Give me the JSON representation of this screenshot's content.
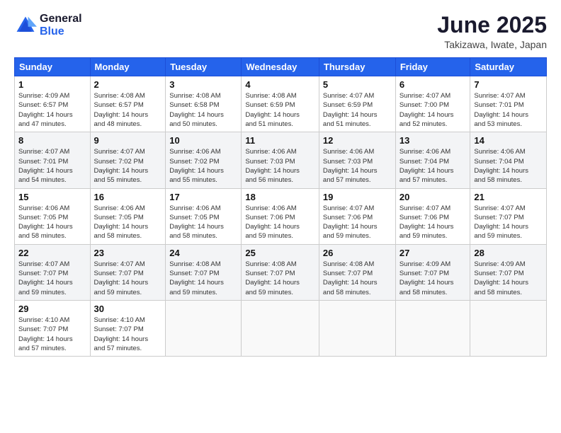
{
  "header": {
    "logo_general": "General",
    "logo_blue": "Blue",
    "title": "June 2025",
    "subtitle": "Takizawa, Iwate, Japan"
  },
  "weekdays": [
    "Sunday",
    "Monday",
    "Tuesday",
    "Wednesday",
    "Thursday",
    "Friday",
    "Saturday"
  ],
  "weeks": [
    [
      {
        "day": "1",
        "info": "Sunrise: 4:09 AM\nSunset: 6:57 PM\nDaylight: 14 hours\nand 47 minutes."
      },
      {
        "day": "2",
        "info": "Sunrise: 4:08 AM\nSunset: 6:57 PM\nDaylight: 14 hours\nand 48 minutes."
      },
      {
        "day": "3",
        "info": "Sunrise: 4:08 AM\nSunset: 6:58 PM\nDaylight: 14 hours\nand 50 minutes."
      },
      {
        "day": "4",
        "info": "Sunrise: 4:08 AM\nSunset: 6:59 PM\nDaylight: 14 hours\nand 51 minutes."
      },
      {
        "day": "5",
        "info": "Sunrise: 4:07 AM\nSunset: 6:59 PM\nDaylight: 14 hours\nand 51 minutes."
      },
      {
        "day": "6",
        "info": "Sunrise: 4:07 AM\nSunset: 7:00 PM\nDaylight: 14 hours\nand 52 minutes."
      },
      {
        "day": "7",
        "info": "Sunrise: 4:07 AM\nSunset: 7:01 PM\nDaylight: 14 hours\nand 53 minutes."
      }
    ],
    [
      {
        "day": "8",
        "info": "Sunrise: 4:07 AM\nSunset: 7:01 PM\nDaylight: 14 hours\nand 54 minutes."
      },
      {
        "day": "9",
        "info": "Sunrise: 4:07 AM\nSunset: 7:02 PM\nDaylight: 14 hours\nand 55 minutes."
      },
      {
        "day": "10",
        "info": "Sunrise: 4:06 AM\nSunset: 7:02 PM\nDaylight: 14 hours\nand 55 minutes."
      },
      {
        "day": "11",
        "info": "Sunrise: 4:06 AM\nSunset: 7:03 PM\nDaylight: 14 hours\nand 56 minutes."
      },
      {
        "day": "12",
        "info": "Sunrise: 4:06 AM\nSunset: 7:03 PM\nDaylight: 14 hours\nand 57 minutes."
      },
      {
        "day": "13",
        "info": "Sunrise: 4:06 AM\nSunset: 7:04 PM\nDaylight: 14 hours\nand 57 minutes."
      },
      {
        "day": "14",
        "info": "Sunrise: 4:06 AM\nSunset: 7:04 PM\nDaylight: 14 hours\nand 58 minutes."
      }
    ],
    [
      {
        "day": "15",
        "info": "Sunrise: 4:06 AM\nSunset: 7:05 PM\nDaylight: 14 hours\nand 58 minutes."
      },
      {
        "day": "16",
        "info": "Sunrise: 4:06 AM\nSunset: 7:05 PM\nDaylight: 14 hours\nand 58 minutes."
      },
      {
        "day": "17",
        "info": "Sunrise: 4:06 AM\nSunset: 7:05 PM\nDaylight: 14 hours\nand 58 minutes."
      },
      {
        "day": "18",
        "info": "Sunrise: 4:06 AM\nSunset: 7:06 PM\nDaylight: 14 hours\nand 59 minutes."
      },
      {
        "day": "19",
        "info": "Sunrise: 4:07 AM\nSunset: 7:06 PM\nDaylight: 14 hours\nand 59 minutes."
      },
      {
        "day": "20",
        "info": "Sunrise: 4:07 AM\nSunset: 7:06 PM\nDaylight: 14 hours\nand 59 minutes."
      },
      {
        "day": "21",
        "info": "Sunrise: 4:07 AM\nSunset: 7:07 PM\nDaylight: 14 hours\nand 59 minutes."
      }
    ],
    [
      {
        "day": "22",
        "info": "Sunrise: 4:07 AM\nSunset: 7:07 PM\nDaylight: 14 hours\nand 59 minutes."
      },
      {
        "day": "23",
        "info": "Sunrise: 4:07 AM\nSunset: 7:07 PM\nDaylight: 14 hours\nand 59 minutes."
      },
      {
        "day": "24",
        "info": "Sunrise: 4:08 AM\nSunset: 7:07 PM\nDaylight: 14 hours\nand 59 minutes."
      },
      {
        "day": "25",
        "info": "Sunrise: 4:08 AM\nSunset: 7:07 PM\nDaylight: 14 hours\nand 59 minutes."
      },
      {
        "day": "26",
        "info": "Sunrise: 4:08 AM\nSunset: 7:07 PM\nDaylight: 14 hours\nand 58 minutes."
      },
      {
        "day": "27",
        "info": "Sunrise: 4:09 AM\nSunset: 7:07 PM\nDaylight: 14 hours\nand 58 minutes."
      },
      {
        "day": "28",
        "info": "Sunrise: 4:09 AM\nSunset: 7:07 PM\nDaylight: 14 hours\nand 58 minutes."
      }
    ],
    [
      {
        "day": "29",
        "info": "Sunrise: 4:10 AM\nSunset: 7:07 PM\nDaylight: 14 hours\nand 57 minutes."
      },
      {
        "day": "30",
        "info": "Sunrise: 4:10 AM\nSunset: 7:07 PM\nDaylight: 14 hours\nand 57 minutes."
      },
      {
        "day": "",
        "info": ""
      },
      {
        "day": "",
        "info": ""
      },
      {
        "day": "",
        "info": ""
      },
      {
        "day": "",
        "info": ""
      },
      {
        "day": "",
        "info": ""
      }
    ]
  ]
}
